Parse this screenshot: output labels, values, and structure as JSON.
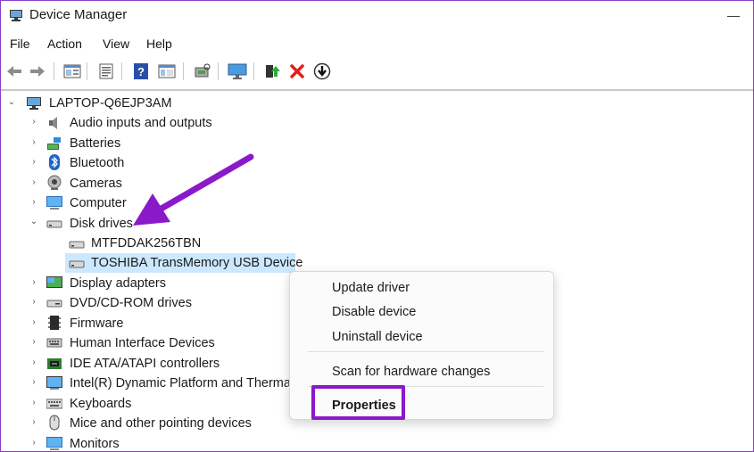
{
  "window": {
    "title": "Device Manager",
    "minimize_glyph": "—"
  },
  "menu": {
    "items": [
      "File",
      "Action",
      "View",
      "Help"
    ]
  },
  "toolbar": {
    "icons": [
      "back-icon",
      "forward-icon",
      "properties-view-icon",
      "list-view-icon",
      "help-icon",
      "console-tree-icon",
      "scan-hardware-icon",
      "monitor-icon",
      "update-driver-icon",
      "uninstall-icon",
      "disable-icon"
    ]
  },
  "tree": {
    "root": "LAPTOP-Q6EJP3AM",
    "categories": [
      {
        "label": "Audio inputs and outputs",
        "icon": "speaker-icon",
        "expanded": false
      },
      {
        "label": "Batteries",
        "icon": "battery-icon",
        "expanded": false
      },
      {
        "label": "Bluetooth",
        "icon": "bluetooth-icon",
        "expanded": false
      },
      {
        "label": "Cameras",
        "icon": "camera-icon",
        "expanded": false
      },
      {
        "label": "Computer",
        "icon": "computer-icon",
        "expanded": false
      },
      {
        "label": "Disk drives",
        "icon": "disk-drive-icon",
        "expanded": true,
        "children": [
          {
            "label": "MTFDDAK256TBN",
            "selected": false
          },
          {
            "label": "TOSHIBA TransMemory USB Device",
            "selected": true
          }
        ]
      },
      {
        "label": "Display adapters",
        "icon": "display-adapter-icon",
        "expanded": false
      },
      {
        "label": "DVD/CD-ROM drives",
        "icon": "dvd-drive-icon",
        "expanded": false
      },
      {
        "label": "Firmware",
        "icon": "firmware-icon",
        "expanded": false
      },
      {
        "label": "Human Interface Devices",
        "icon": "hid-icon",
        "expanded": false
      },
      {
        "label": "IDE ATA/ATAPI controllers",
        "icon": "ide-controller-icon",
        "expanded": false
      },
      {
        "label": "Intel(R) Dynamic Platform and Therma",
        "icon": "intel-platform-icon",
        "expanded": false
      },
      {
        "label": "Keyboards",
        "icon": "keyboard-icon",
        "expanded": false
      },
      {
        "label": "Mice and other pointing devices",
        "icon": "mouse-icon",
        "expanded": false
      },
      {
        "label": "Monitors",
        "icon": "monitor-icon",
        "expanded": false
      }
    ]
  },
  "context_menu": {
    "items": [
      "Update driver",
      "Disable device",
      "Uninstall device",
      "Scan for hardware changes",
      "Properties"
    ],
    "highlighted": "Properties"
  },
  "annotation": {
    "arrow_color": "#8a19c9",
    "highlight_color": "#8a19c9"
  }
}
